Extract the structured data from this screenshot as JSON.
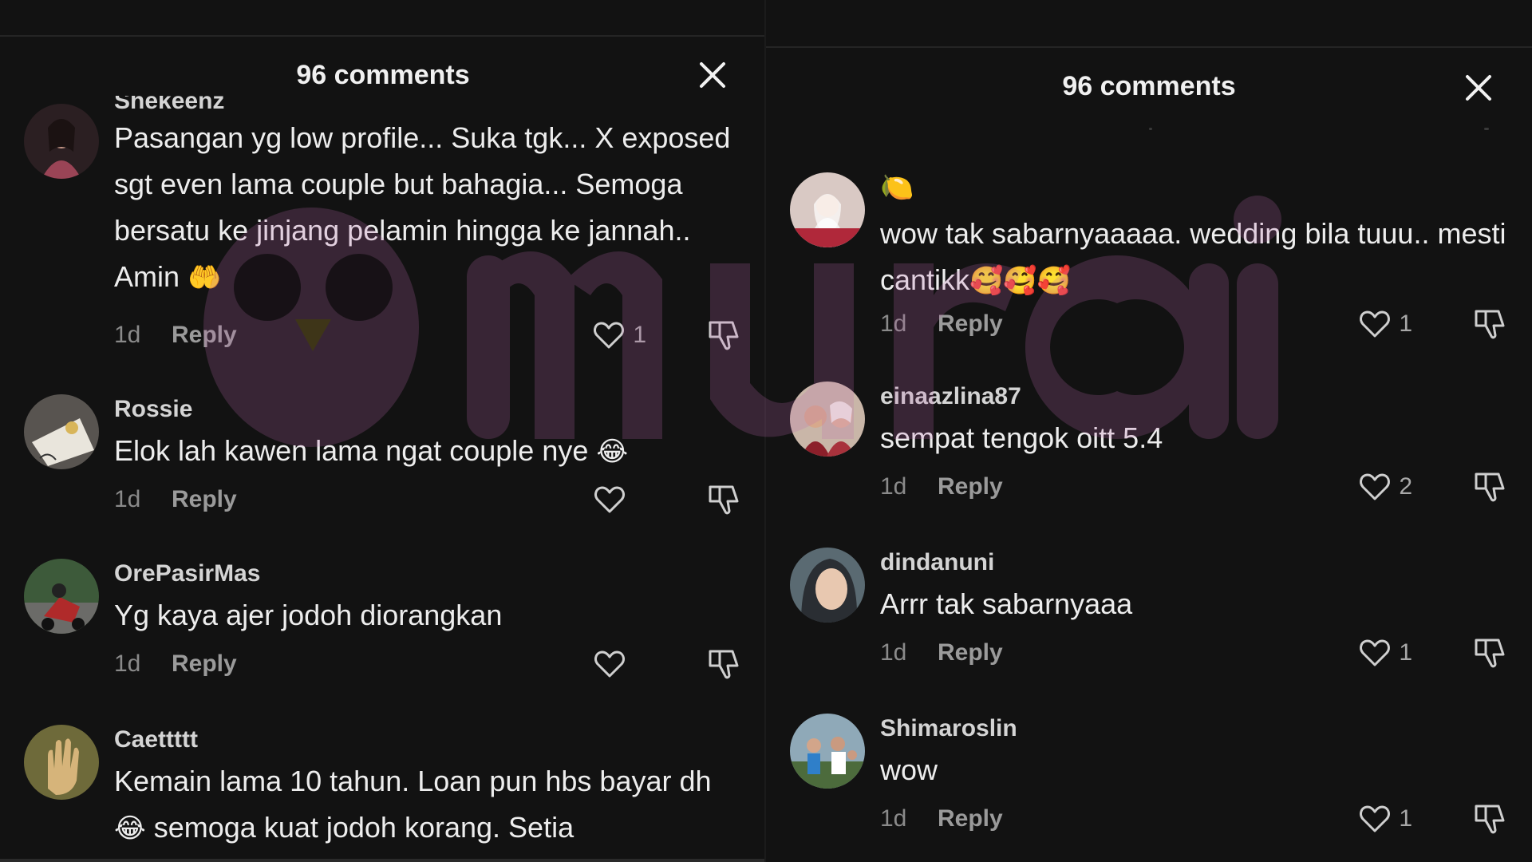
{
  "left_panel": {
    "title": "96 comments",
    "comments": [
      {
        "username": "Shekeenz",
        "text": "Pasangan yg low profile... Suka tgk... X exposed sgt even lama couple but bahagia... Semoga bersatu ke jinjang pelamin hingga ke jannah.. Amin",
        "emoji": "🤲",
        "time": "1d",
        "reply_label": "Reply",
        "likes": "1"
      },
      {
        "username": "Rossie",
        "text": "Elok lah kawen lama ngat couple nye",
        "emoji": "😂",
        "time": "1d",
        "reply_label": "Reply",
        "likes": ""
      },
      {
        "username": "OrePasirMas",
        "text": "Yg kaya ajer jodoh diorangkan",
        "emoji": "",
        "time": "1d",
        "reply_label": "Reply",
        "likes": ""
      },
      {
        "username": "Caettttt",
        "text_part1": "Kemain lama 10 tahun. Loan pun hbs bayar dh",
        "emoji": "😂",
        "text_part2": "semoga kuat jodoh korang. Setia",
        "time": "",
        "reply_label": "",
        "likes": ""
      }
    ]
  },
  "right_panel": {
    "title": "96 comments",
    "comments": [
      {
        "username_emoji": "🍋",
        "text": "wow tak sabarnyaaaaa. wedding bila tuuu.. mesti cantikk",
        "emoji": "🥰🥰🥰",
        "time": "1d",
        "reply_label": "Reply",
        "likes": "1"
      },
      {
        "username": "einaazlina87",
        "text": "sempat tengok oitt 5.4",
        "time": "1d",
        "reply_label": "Reply",
        "likes": "2"
      },
      {
        "username": "dindanuni",
        "text": "Arrr tak sabarnyaaa",
        "time": "1d",
        "reply_label": "Reply",
        "likes": "1"
      },
      {
        "username": "Shimaroslin",
        "text": "wow",
        "time": "1d",
        "reply_label": "Reply",
        "likes": "1"
      }
    ]
  },
  "watermark": {
    "text": "murai"
  },
  "icons": {
    "close": "close-icon",
    "like": "heart-icon",
    "dislike": "thumbs-down-icon"
  },
  "colors": {
    "background": "#121212",
    "text": "#ededed",
    "muted": "#8a8a8a",
    "watermark": "#c06bb0"
  }
}
